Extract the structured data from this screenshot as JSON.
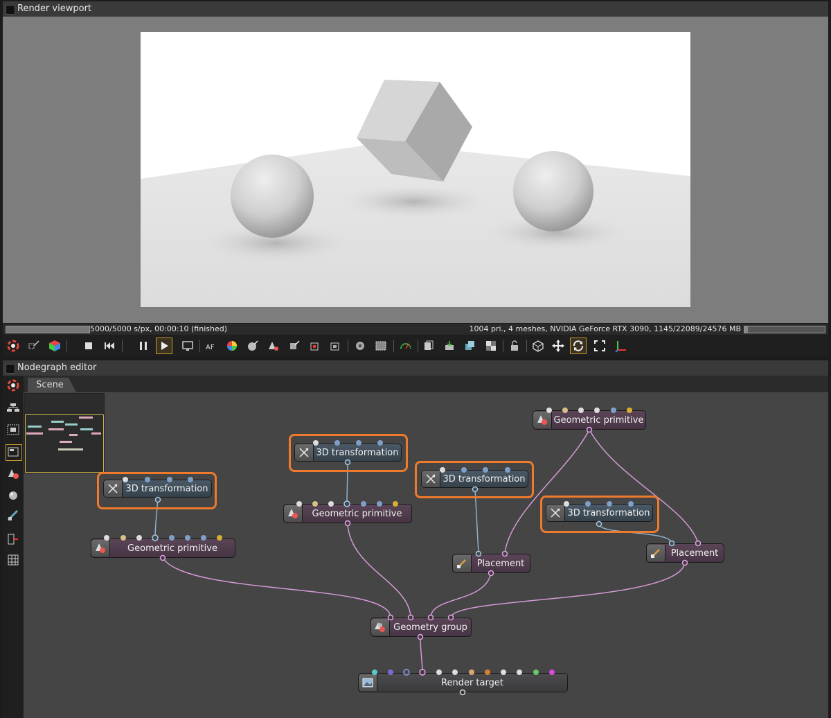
{
  "viewport": {
    "title": "Render viewport",
    "status_left": "5000/5000 s/px, 00:00:10 (finished)",
    "status_right": "1004 pri., 4 meshes, NVIDIA GeForce RTX 3090, 1145/22089/24576 MB",
    "progress": 1.0,
    "memory_fraction": 0.047
  },
  "toolbar": {
    "buttons": [
      "reset-camera-icon",
      "picker-icon",
      "color-cube-icon",
      "stop-icon",
      "restart-icon",
      "pause-icon",
      "play-icon",
      "monitor-icon",
      "af-icon",
      "color-wheel-icon",
      "material-picker-icon",
      "light-picker-icon",
      "object-picker-icon",
      "focus-picker-icon",
      "camera-picker-icon",
      "region-icon",
      "film-region-icon",
      "gauge-icon",
      "copy-icon",
      "export-icon",
      "layers-icon",
      "checker-icon",
      "lock-icon",
      "cube-view-icon",
      "move-icon",
      "orbit-icon",
      "fullscreen-icon",
      "axis-icon"
    ]
  },
  "nodegraph": {
    "title": "Nodegraph editor",
    "tab": "Scene",
    "nodes": {
      "t1": "3D transformation",
      "t2": "3D transformation",
      "t3": "3D transformation",
      "t4": "3D transformation",
      "g1": "Geometric primitive",
      "g2": "Geometric primitive",
      "g3": "Geometric primitive",
      "p1": "Placement",
      "p2": "Placement",
      "group": "Geometry group",
      "rt": "Render target"
    }
  },
  "colors": {
    "highlight": "#ef7a2b",
    "geo_link": "#d49ad6",
    "tr_link": "#8eb2cc",
    "active_button": "#c99a2e"
  }
}
